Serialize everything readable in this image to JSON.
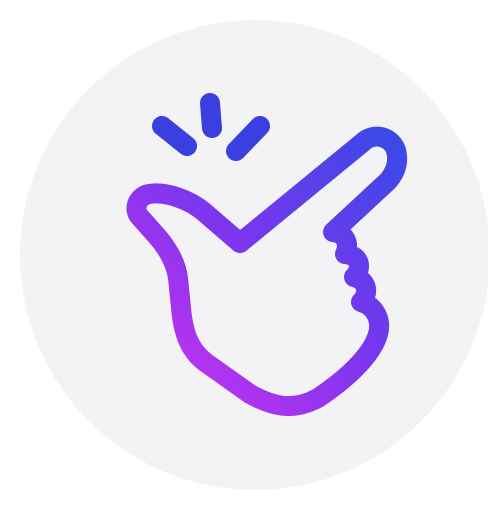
{
  "icon": {
    "name": "finger-snap-icon",
    "gradient_start": "#3f46e8",
    "gradient_end": "#c733f0",
    "background_color": "#f3f3f5"
  }
}
